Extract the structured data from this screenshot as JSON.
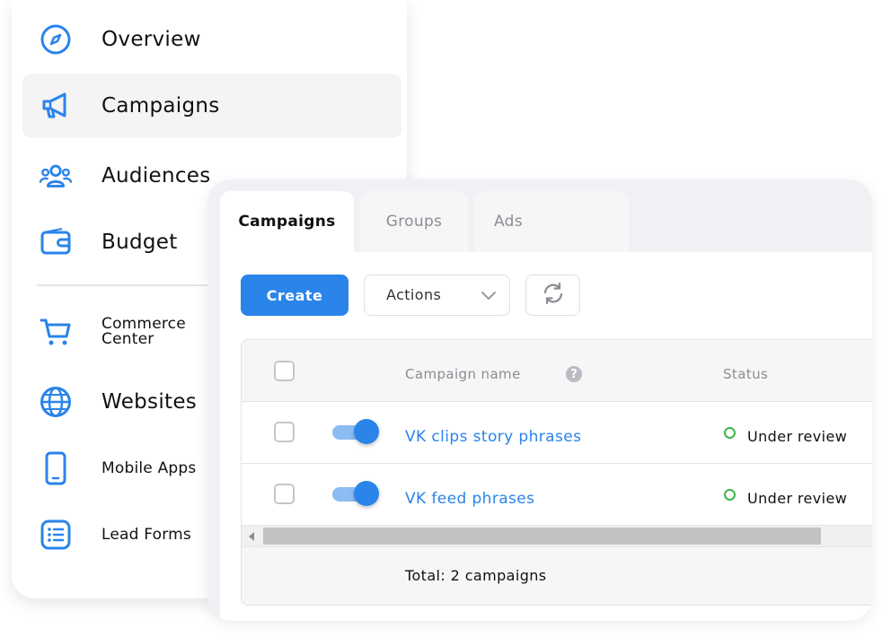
{
  "sidebar": {
    "items": [
      {
        "label": "Overview",
        "icon": "compass-icon",
        "active": false
      },
      {
        "label": "Campaigns",
        "icon": "megaphone-icon",
        "active": true
      },
      {
        "label": "Audiences",
        "icon": "audience-icon",
        "active": false
      },
      {
        "label": "Budget",
        "icon": "wallet-icon",
        "active": false
      },
      {
        "label": "Commerce\nCenter",
        "icon": "cart-icon",
        "active": false
      },
      {
        "label": "Websites",
        "icon": "globe-icon",
        "active": false
      },
      {
        "label": "Mobile Apps",
        "icon": "phone-icon",
        "active": false
      },
      {
        "label": "Lead Forms",
        "icon": "form-list-icon",
        "active": false
      }
    ]
  },
  "tabs": [
    {
      "label": "Campaigns",
      "active": true
    },
    {
      "label": "Groups",
      "active": false
    },
    {
      "label": "Ads",
      "active": false
    }
  ],
  "toolbar": {
    "create_label": "Create",
    "actions_label": "Actions"
  },
  "table": {
    "columns": {
      "name": "Campaign name",
      "status": "Status"
    },
    "rows": [
      {
        "name": "VK clips story phrases",
        "status": "Under review",
        "enabled": true
      },
      {
        "name": "VK feed phrases",
        "status": "Under review",
        "enabled": true
      }
    ],
    "total": "Total: 2 campaigns"
  },
  "colors": {
    "accent": "#2a84ea",
    "status_ok": "#3fb54a"
  }
}
